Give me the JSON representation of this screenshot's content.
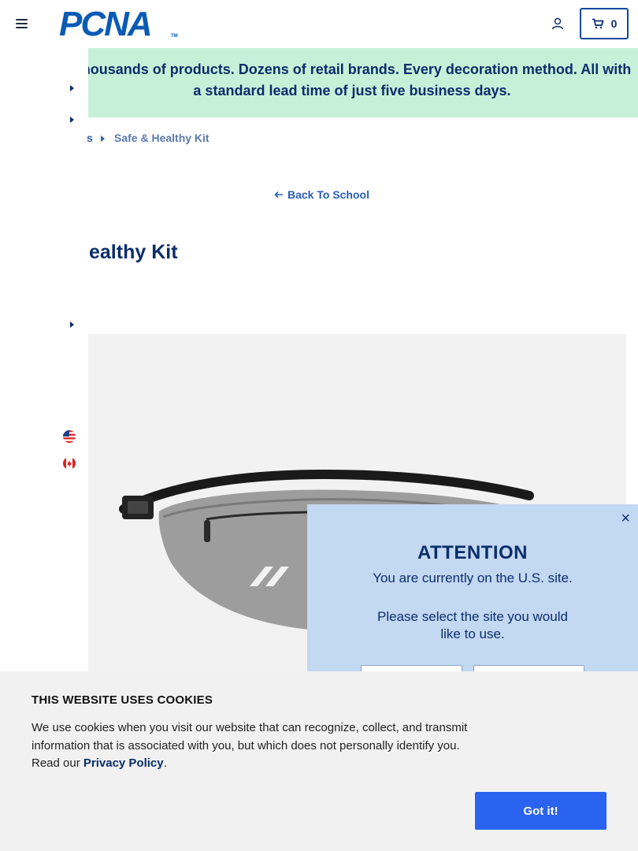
{
  "header": {
    "logo_text": "PCNA",
    "logo_tm": "TM",
    "menu_icon": "hamburger-icon",
    "account_icon": "user-icon",
    "cart_icon": "cart-icon",
    "cart_count": "0"
  },
  "promo": {
    "text": "Thousands of products. Dozens of retail brands. Every decoration method. All with a standard lead time of just five business days."
  },
  "side_menu": {
    "caret_icon": "chevron-right-icon",
    "flags": [
      "us-flag-icon",
      "canada-flag-icon"
    ]
  },
  "breadcrumb": {
    "previous": "s",
    "separator_icon": "chevron-right-icon",
    "current": "Safe & Healthy Kit"
  },
  "back_link": {
    "icon": "arrow-left-icon",
    "label": "Back To School"
  },
  "page_title": "ealthy Kit",
  "modal": {
    "close_label": "×",
    "title": "ATTENTION",
    "line1": "You are currently on the U.S. site.",
    "line2": "Please select the site you would like to use."
  },
  "cookie_banner": {
    "title": "THIS WEBSITE USES COOKIES",
    "body": "We use cookies when you visit our website that can recognize, collect, and transmit information that is associated with you, but which does not personally identify you. Read our ",
    "link_label": "Privacy Policy",
    "body_end": ".",
    "button_label": "Got it!"
  },
  "colors": {
    "brand_blue": "#0a5bb5",
    "navy": "#0b2d6b",
    "promo_green": "#c7f0d8",
    "modal_blue": "#c3d8f1",
    "cookie_button": "#2a63ef"
  }
}
